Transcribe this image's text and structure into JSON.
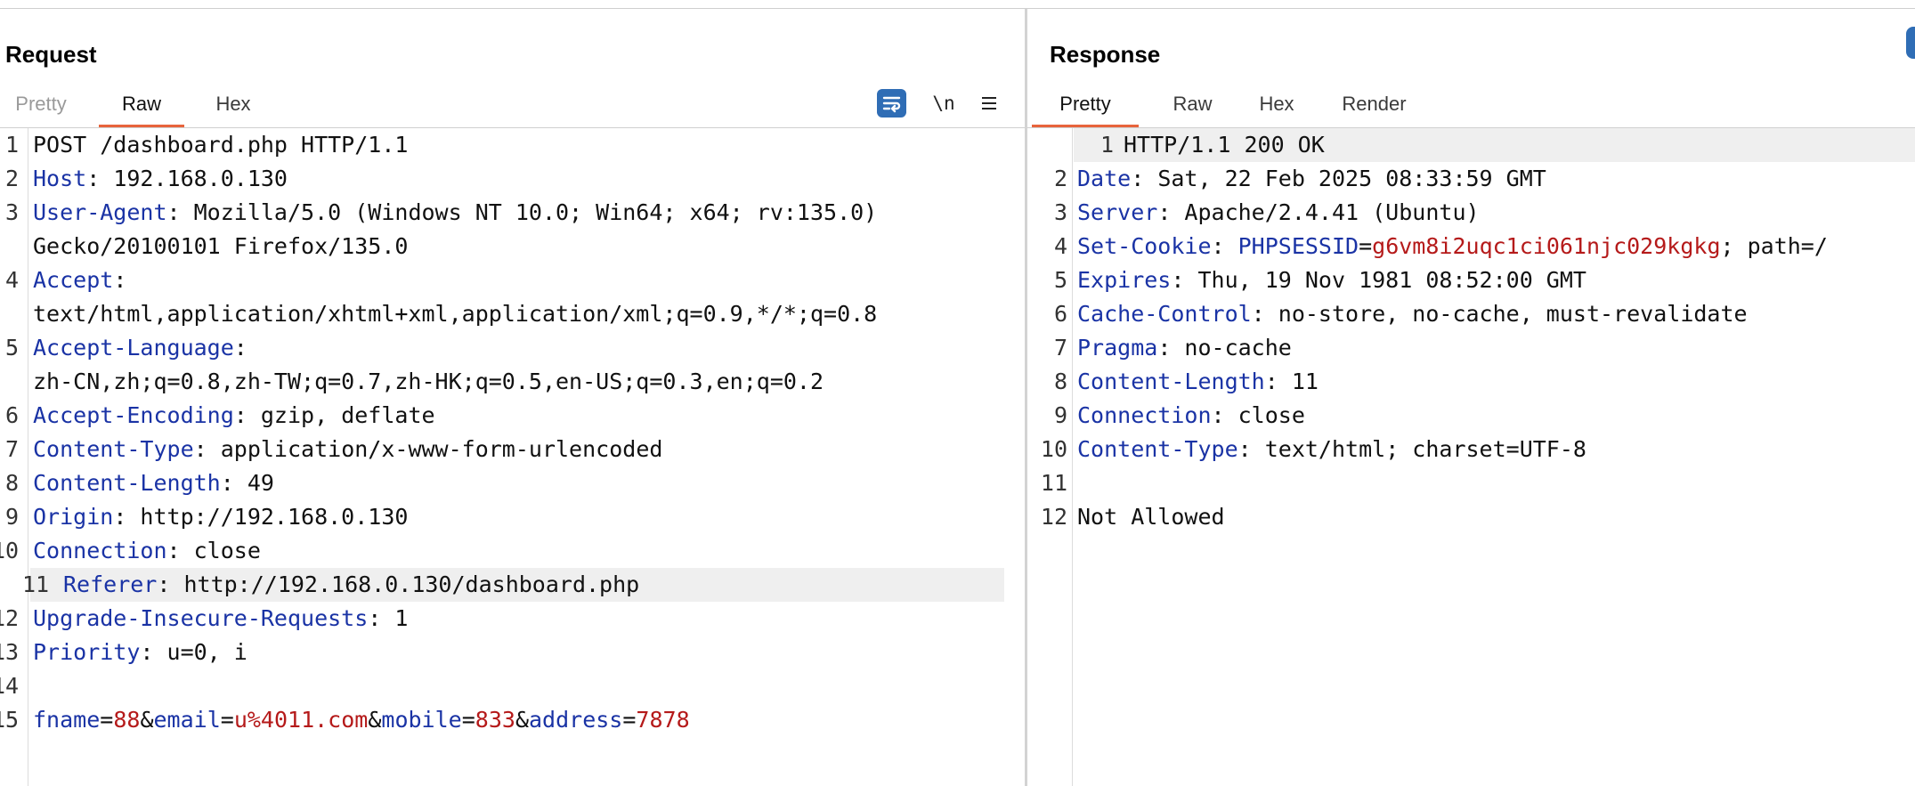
{
  "colors": {
    "accent_tab": "#e8643c",
    "header_key": "#1a33a5",
    "param_value": "#b51a1a",
    "toolbar_icon_bg": "#2f6db5"
  },
  "request": {
    "title": "Request",
    "tabs": [
      "Pretty",
      "Raw",
      "Hex"
    ],
    "active_tab": "Raw",
    "toolbar": {
      "wrap_icon": "word-wrap-icon",
      "newline_label": "\\n",
      "menu_icon": "hamburger-menu-icon"
    },
    "lines": [
      {
        "n": "1",
        "text": "POST /dashboard.php HTTP/1.1"
      },
      {
        "n": "2",
        "key": "Host",
        "rest": ": 192.168.0.130"
      },
      {
        "n": "3",
        "key": "User-Agent",
        "rest": ": Mozilla/5.0 (Windows NT 10.0; Win64; x64; rv:135.0)"
      },
      {
        "n": "",
        "text": "Gecko/20100101 Firefox/135.0"
      },
      {
        "n": "4",
        "key": "Accept",
        "rest": ":"
      },
      {
        "n": "",
        "text": "text/html,application/xhtml+xml,application/xml;q=0.9,*/*;q=0.8"
      },
      {
        "n": "5",
        "key": "Accept-Language",
        "rest": ":"
      },
      {
        "n": "",
        "text": "zh-CN,zh;q=0.8,zh-TW;q=0.7,zh-HK;q=0.5,en-US;q=0.3,en;q=0.2"
      },
      {
        "n": "6",
        "key": "Accept-Encoding",
        "rest": ": gzip, deflate"
      },
      {
        "n": "7",
        "key": "Content-Type",
        "rest": ": application/x-www-form-urlencoded"
      },
      {
        "n": "8",
        "key": "Content-Length",
        "rest": ": 49"
      },
      {
        "n": "9",
        "key": "Origin",
        "rest": ": http://192.168.0.130"
      },
      {
        "n": "10",
        "key": "Connection",
        "rest": ": close"
      },
      {
        "n": "11",
        "key": "Referer",
        "rest": ": http://192.168.0.130/dashboard.php",
        "highlight": true
      },
      {
        "n": "12",
        "key": "Upgrade-Insecure-Requests",
        "rest": ": 1"
      },
      {
        "n": "13",
        "key": "Priority",
        "rest": ": u=0, i"
      },
      {
        "n": "14",
        "text": ""
      },
      {
        "n": "15",
        "params": [
          {
            "k": "fname",
            "v": "88"
          },
          {
            "k": "email",
            "v": "u%4011.com"
          },
          {
            "k": "mobile",
            "v": "833"
          },
          {
            "k": "address",
            "v": "7878"
          }
        ]
      }
    ]
  },
  "response": {
    "title": "Response",
    "tabs": [
      "Pretty",
      "Raw",
      "Hex",
      "Render"
    ],
    "active_tab": "Pretty",
    "lines": [
      {
        "n": "1",
        "text": "HTTP/1.1 200 OK",
        "highlight": true
      },
      {
        "n": "2",
        "key": "Date",
        "rest": ": Sat, 22 Feb 2025 08:33:59 GMT"
      },
      {
        "n": "3",
        "key": "Server",
        "rest": ": Apache/2.4.41 (Ubuntu)"
      },
      {
        "n": "4",
        "key": "Set-Cookie",
        "rest": ": ",
        "cookie": {
          "name": "PHPSESSID",
          "value": "g6vm8i2uqc1ci061njc029kgkg",
          "tail": "; path=/"
        }
      },
      {
        "n": "5",
        "key": "Expires",
        "rest": ": Thu, 19 Nov 1981 08:52:00 GMT"
      },
      {
        "n": "6",
        "key": "Cache-Control",
        "rest": ": no-store, no-cache, must-revalidate"
      },
      {
        "n": "7",
        "key": "Pragma",
        "rest": ": no-cache"
      },
      {
        "n": "8",
        "key": "Content-Length",
        "rest": ": 11"
      },
      {
        "n": "9",
        "key": "Connection",
        "rest": ": close"
      },
      {
        "n": "10",
        "key": "Content-Type",
        "rest": ": text/html; charset=UTF-8"
      },
      {
        "n": "11",
        "text": ""
      },
      {
        "n": "12",
        "text": "Not Allowed"
      }
    ]
  }
}
